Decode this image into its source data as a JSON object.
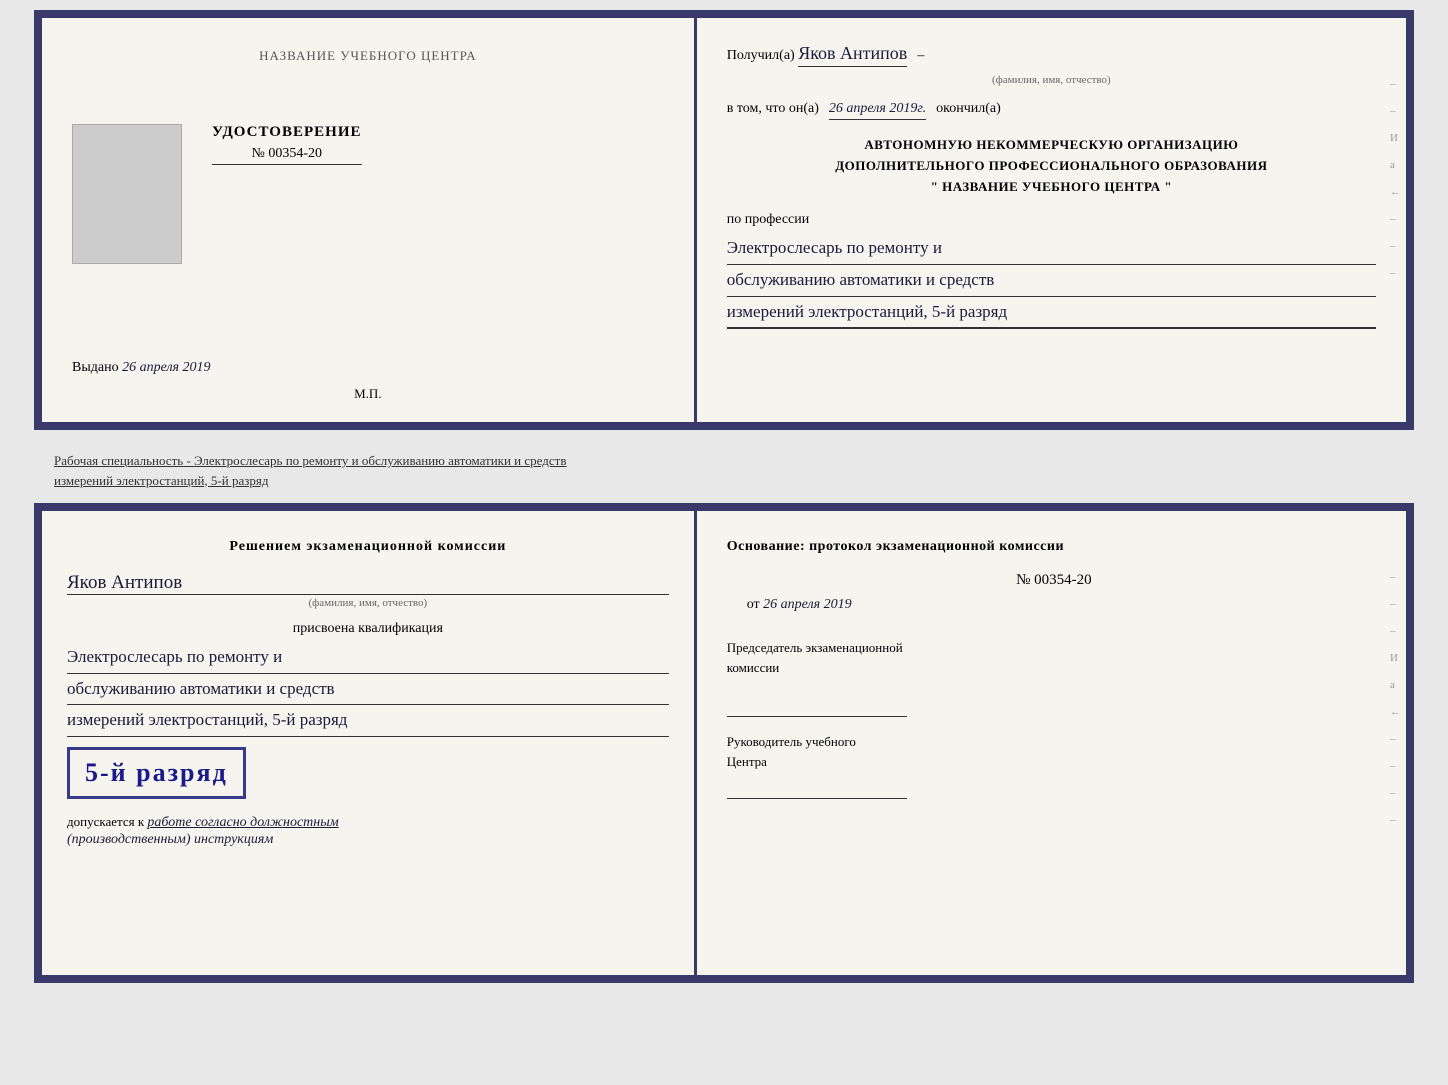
{
  "top": {
    "left": {
      "schoolName": "НАЗВАНИЕ УЧЕБНОГО ЦЕНТРА",
      "udostoverenie": "УДОСТОВЕРЕНИЕ",
      "number": "№ 00354-20",
      "vydano": "Выдано",
      "vydanoDate": "26 апреля 2019",
      "mp": "М.П."
    },
    "right": {
      "poluchilLabel": "Получил(а)",
      "fioValue": "Яков Антипов",
      "fioSubLabel": "(фамилия, имя, отчество)",
      "vtomLabel": "в том, что он(а)",
      "vtomDate": "26 апреля 2019г.",
      "okonchilLabel": "окончил(а)",
      "orgLine1": "АВТОНОМНУЮ НЕКОММЕРЧЕСКУЮ ОРГАНИЗАЦИЮ",
      "orgLine2": "ДОПОЛНИТЕЛЬНОГО ПРОФЕССИОНАЛЬНОГО ОБРАЗОВАНИЯ",
      "orgLine3": "\"   НАЗВАНИЕ УЧЕБНОГО ЦЕНТРА   \"",
      "poProfessii": "по профессии",
      "profession1": "Электрослесарь по ремонту и",
      "profession2": "обслуживанию автоматики и средств",
      "profession3": "измерений электростанций, 5-й разряд"
    }
  },
  "separator": {
    "text": "Рабочая специальность - Электрослесарь по ремонту и обслуживанию автоматики и средств",
    "text2": "измерений электростанций, 5-й разряд"
  },
  "bottom": {
    "left": {
      "resheniemTitle": "Решением экзаменационной комиссии",
      "fio": "Яков Антипов",
      "fioSubLabel": "(фамилия, имя, отчество)",
      "prisvoyena": "присвоена квалификация",
      "prof1": "Электрослесарь по ремонту и",
      "prof2": "обслуживанию автоматики и средств",
      "prof3": "измерений электростанций, 5-й разряд",
      "razryadBadge": "5-й разряд",
      "dopuskaetsya": "допускается к",
      "dopuskaetsyaText": "работе согласно должностным",
      "dopuskaetsyaText2": "(производственным) инструкциям"
    },
    "right": {
      "osnovanie": "Основание: протокол экзаменационной комиссии",
      "number": "№ 00354-20",
      "ot": "от",
      "date": "26 апреля 2019",
      "predsedatel1": "Председатель экзаменационной",
      "predsedatel2": "комиссии",
      "rukovoditel1": "Руководитель учебного",
      "rukovoditel2": "Центра"
    }
  }
}
